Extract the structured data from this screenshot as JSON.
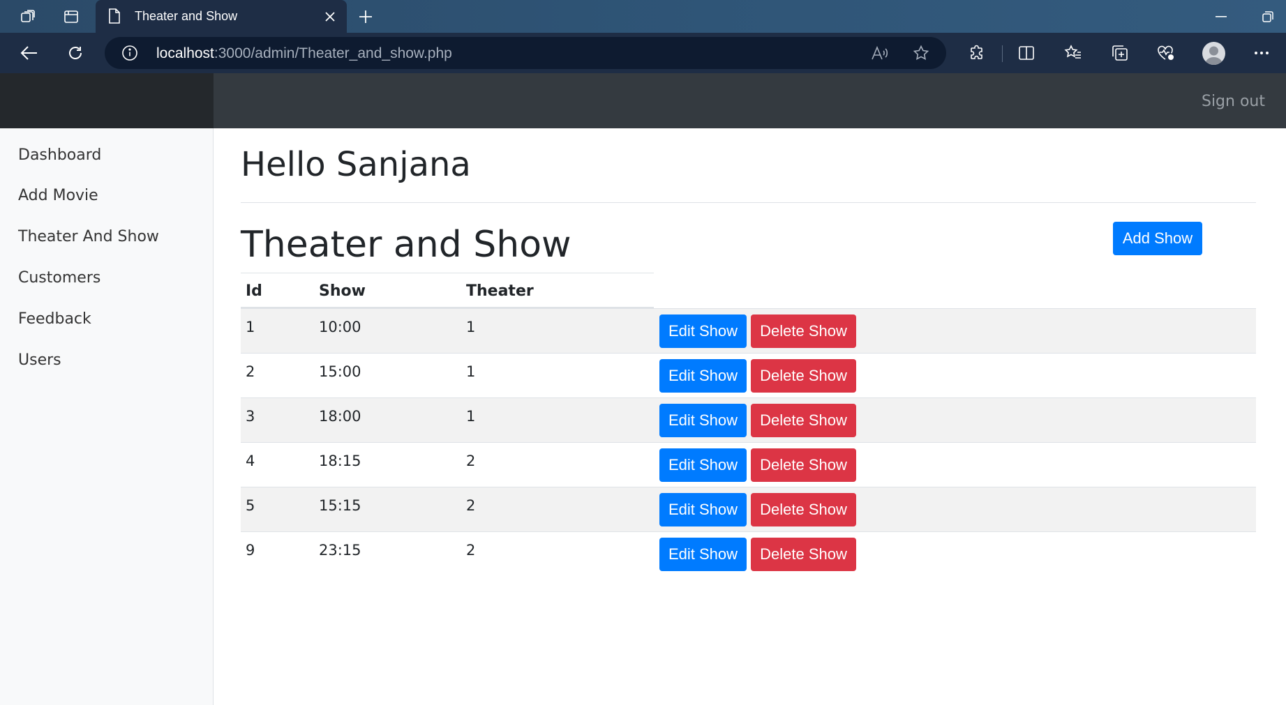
{
  "browser": {
    "tab_title": "Theater and Show",
    "url_host": "localhost",
    "url_rest": ":3000/admin/Theater_and_show.php"
  },
  "header": {
    "signout_label": "Sign out"
  },
  "sidebar": {
    "items": [
      {
        "label": "Dashboard"
      },
      {
        "label": "Add Movie"
      },
      {
        "label": "Theater And Show"
      },
      {
        "label": "Customers"
      },
      {
        "label": "Feedback"
      },
      {
        "label": "Users"
      }
    ]
  },
  "main": {
    "greeting": "Hello Sanjana",
    "title": "Theater and Show",
    "add_button": "Add Show",
    "columns": [
      "Id",
      "Show",
      "Theater"
    ],
    "edit_label": "Edit Show",
    "delete_label": "Delete Show",
    "rows": [
      {
        "id": "1",
        "show": "10:00",
        "theater": "1"
      },
      {
        "id": "2",
        "show": "15:00",
        "theater": "1"
      },
      {
        "id": "3",
        "show": "18:00",
        "theater": "1"
      },
      {
        "id": "4",
        "show": "18:15",
        "theater": "2"
      },
      {
        "id": "5",
        "show": "15:15",
        "theater": "2"
      },
      {
        "id": "9",
        "show": "23:15",
        "theater": "2"
      }
    ]
  },
  "colors": {
    "primary": "#007bff",
    "danger": "#dc3545",
    "header_dark": "#343a40"
  }
}
